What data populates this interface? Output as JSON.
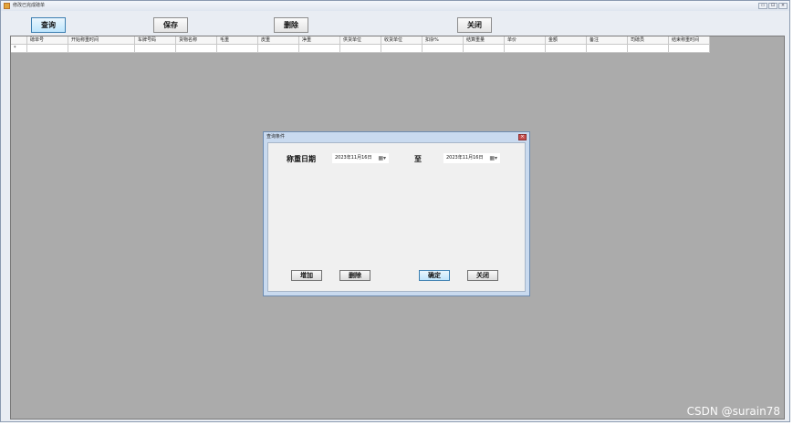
{
  "window": {
    "title": "修改已完成磅单",
    "controls": [
      "▭",
      "⊡",
      "×"
    ]
  },
  "toolbar": {
    "query": "查询",
    "save": "保存",
    "delete": "删除",
    "close": "关闭"
  },
  "grid": {
    "columns": [
      "磅单号",
      "开始称重时间",
      "车牌号码",
      "货物名称",
      "毛重",
      "皮重",
      "净重",
      "供货单位",
      "收货单位",
      "扣杂%",
      "结算重量",
      "单价",
      "金额",
      "备注",
      "司磅员",
      "结束称重时间"
    ],
    "new_row_marker": "*"
  },
  "dialog": {
    "title": "查询条件",
    "date_label": "称重日期",
    "to_label": "至",
    "date_from": "2023年11月16日",
    "date_to": "2023年11月16日",
    "buttons": {
      "add": "增加",
      "delete": "删除",
      "ok": "确定",
      "close": "关闭"
    }
  },
  "watermark": "CSDN @surain78"
}
